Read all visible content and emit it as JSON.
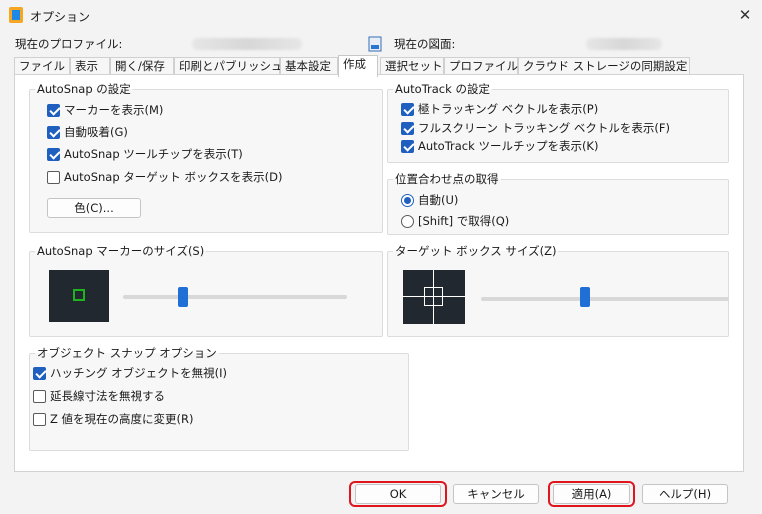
{
  "window": {
    "title": "オプション",
    "close_glyph": "✕"
  },
  "profile": {
    "current_profile_label": "現在のプロファイル:",
    "current_drawing_label": "現在の図面:"
  },
  "tabs": [
    {
      "label": "ファイル"
    },
    {
      "label": "表示"
    },
    {
      "label": "開く/保存"
    },
    {
      "label": "印刷とパブリッシュ"
    },
    {
      "label": "基本設定"
    },
    {
      "label": "作成"
    },
    {
      "label": "選択セット"
    },
    {
      "label": "プロファイル"
    },
    {
      "label": "クラウド ストレージの同期設定"
    }
  ],
  "active_tab": "作成",
  "autosnap": {
    "title": "AutoSnap の設定",
    "items": [
      {
        "label": "マーカーを表示(M)",
        "checked": true
      },
      {
        "label": "自動吸着(G)",
        "checked": true
      },
      {
        "label": "AutoSnap ツールチップを表示(T)",
        "checked": true
      },
      {
        "label": "AutoSnap ターゲット ボックスを表示(D)",
        "checked": false
      }
    ],
    "color_button": "色(C)..."
  },
  "autotrack": {
    "title": "AutoTrack の設定",
    "items": [
      {
        "label": "極トラッキング ベクトルを表示(P)",
        "checked": true
      },
      {
        "label": "フルスクリーン トラッキング ベクトルを表示(F)",
        "checked": true
      },
      {
        "label": "AutoTrack ツールチップを表示(K)",
        "checked": true
      }
    ]
  },
  "alignment": {
    "title": "位置合わせ点の取得",
    "options": [
      {
        "label": "自動(U)",
        "selected": true
      },
      {
        "label": "[Shift] で取得(Q)",
        "selected": false
      }
    ]
  },
  "marker_size": {
    "title": "AutoSnap マーカーのサイズ(S)",
    "value_fraction": 0.27
  },
  "aperture_size": {
    "title": "ターゲット ボックス サイズ(Z)",
    "value_fraction": 0.42
  },
  "object_snap": {
    "title": "オブジェクト スナップ オプション",
    "items": [
      {
        "label": "ハッチング オブジェクトを無視(I)",
        "checked": true
      },
      {
        "label": "延長線寸法を無視する",
        "checked": false
      },
      {
        "label": "Z 値を現在の高度に変更(R)",
        "checked": false
      }
    ]
  },
  "buttons": {
    "ok": "OK",
    "cancel": "キャンセル",
    "apply": "適用(A)",
    "help": "ヘルプ(H)"
  },
  "colors": {
    "accent": "#1f5fbf",
    "highlight": "#e0161e",
    "preview_bg": "#212830",
    "marker": "#1fb31f"
  }
}
